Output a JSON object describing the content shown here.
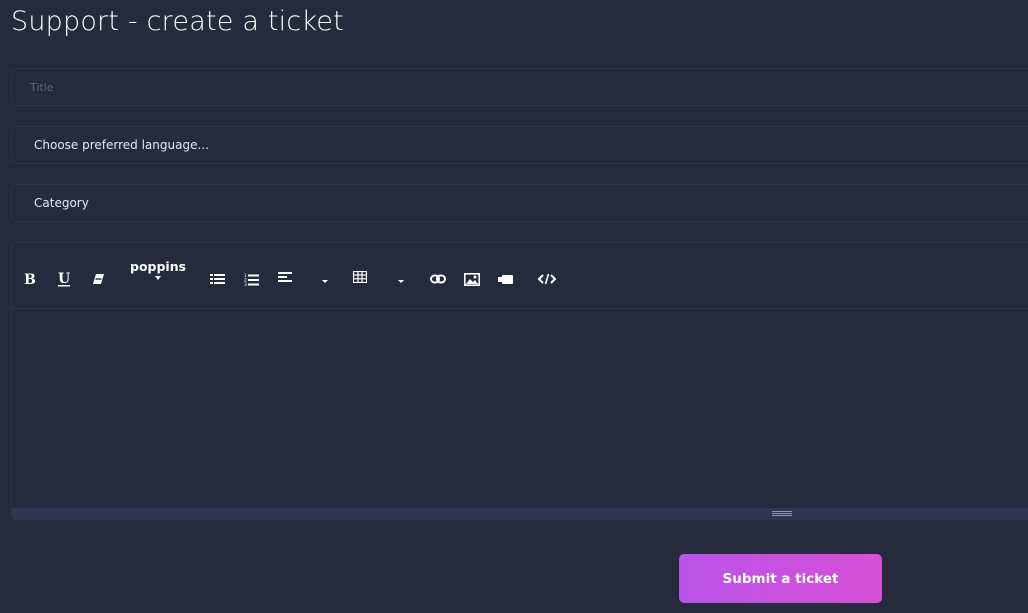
{
  "page": {
    "title": "Support - create a ticket"
  },
  "form": {
    "title_placeholder": "Title",
    "language_select": "Choose preferred language...",
    "category_select": "Category"
  },
  "editor": {
    "font_name": "poppins",
    "tools": [
      "bold-icon",
      "underline-icon",
      "eraser-icon",
      "font-dropdown",
      "unordered-list-icon",
      "ordered-list-icon",
      "align-icon",
      "table-icon",
      "link-icon",
      "image-icon",
      "video-icon",
      "code-view-icon"
    ]
  },
  "actions": {
    "submit_label": "Submit a ticket"
  },
  "colors": {
    "background": "#262a3d",
    "border": "#30344a",
    "button_gradient_start": "#b953e8",
    "button_gradient_end": "#d84fd7"
  }
}
